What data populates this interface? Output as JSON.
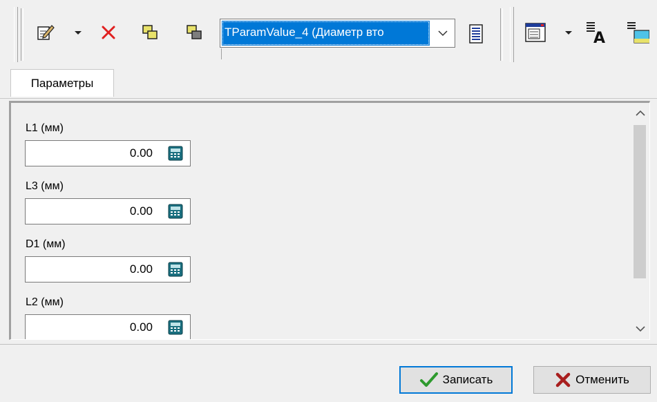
{
  "toolbar": {
    "record_select": {
      "value": "TParamValue_4 (Диаметр вто"
    },
    "icons": [
      "edit-icon",
      "delete-icon",
      "copy-icon",
      "paste-icon",
      "list-icon",
      "form-view-icon",
      "font-icon",
      "image-icon"
    ]
  },
  "tabs": [
    {
      "label": "Параметры"
    }
  ],
  "fields": [
    {
      "label": "L1 (мм)",
      "value": "0.00"
    },
    {
      "label": "L3 (мм)",
      "value": "0.00"
    },
    {
      "label": "D1 (мм)",
      "value": "0.00"
    },
    {
      "label": "L2 (мм)",
      "value": "0.00"
    }
  ],
  "buttons": {
    "save_label": "Записать",
    "cancel_label": "Отменить"
  },
  "colors": {
    "accent": "#0078d7",
    "delete": "#e02020",
    "calc": "#1a6f7f"
  }
}
